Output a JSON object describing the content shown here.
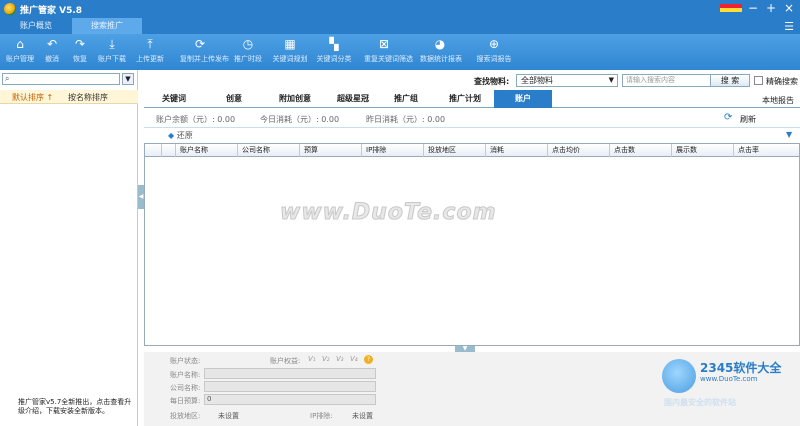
{
  "app": {
    "title": "推广管家 V5.8"
  },
  "tabs": [
    {
      "label": "账户概览",
      "active": false
    },
    {
      "label": "搜索推广",
      "active": true
    }
  ],
  "toolbar": [
    {
      "label": "账户管理",
      "icon": "home-icon"
    },
    {
      "label": "撤消",
      "icon": "undo-icon"
    },
    {
      "label": "恢复",
      "icon": "redo-icon"
    },
    {
      "label": "账户下载",
      "icon": "download-icon"
    },
    {
      "label": "上传更新",
      "icon": "upload-icon"
    },
    {
      "label": "复制并上传发布",
      "icon": "refresh-icon"
    },
    {
      "label": "推广时段",
      "icon": "clock-icon"
    },
    {
      "label": "关键词规划",
      "icon": "chart-icon"
    },
    {
      "label": "关键词分类",
      "icon": "grid-icon"
    },
    {
      "label": "重复关键词筛选",
      "icon": "filter-icon"
    },
    {
      "label": "数据统计报表",
      "icon": "pie-icon"
    },
    {
      "label": "搜索词报告",
      "icon": "search-report-icon"
    }
  ],
  "left": {
    "search_placeholder": "",
    "sort": {
      "default": "默认排序 ↑",
      "by_name": "按名称排序"
    },
    "notice": "推广管家v5.7全新推出，点击查看升级介绍，下载安装全新版本。"
  },
  "find": {
    "label": "查找物料:",
    "select_value": "全部物料",
    "keyword_placeholder": "请输入搜索内容",
    "search_button": "搜 索",
    "exact_label": "精确搜索"
  },
  "subtabs": [
    {
      "label": "关键词",
      "active": false
    },
    {
      "label": "创意",
      "active": false
    },
    {
      "label": "附加创意",
      "active": false
    },
    {
      "label": "超级星冠",
      "active": false
    },
    {
      "label": "推广组",
      "active": false
    },
    {
      "label": "推广计划",
      "active": false
    },
    {
      "label": "账户",
      "active": true
    }
  ],
  "local_report": "本地报告",
  "stats": {
    "balance": "账户余额（元）: 0.00",
    "today": "今日消耗（元）: 0.00",
    "yesterday": "昨日消耗（元）: 0.00",
    "refresh": "刷新"
  },
  "restore": "还原",
  "grid": {
    "columns": [
      "账户名称",
      "公司名称",
      "预算",
      "IP排除",
      "投放地区",
      "消耗",
      "点击均价",
      "点击数",
      "展示数",
      "点击率"
    ]
  },
  "watermark": "www.DuoTe.com",
  "detail": {
    "account_status": "账户状态:",
    "account_rights": "账户权益:",
    "rights_badges": [
      "V₁",
      "V₂",
      "V₃",
      "V₄"
    ],
    "account_name": "账户名称:",
    "company_name": "公司名称:",
    "daily_budget": "每日预算:",
    "daily_budget_value": "0",
    "region": "投放地区:",
    "region_value": "未设置",
    "ip_exclude": "IP排除:",
    "ip_exclude_value": "未设置"
  },
  "brand": {
    "name": "2345软件大全",
    "url": "www.DuoTe.com",
    "slogan": "国内最安全的软件站"
  }
}
